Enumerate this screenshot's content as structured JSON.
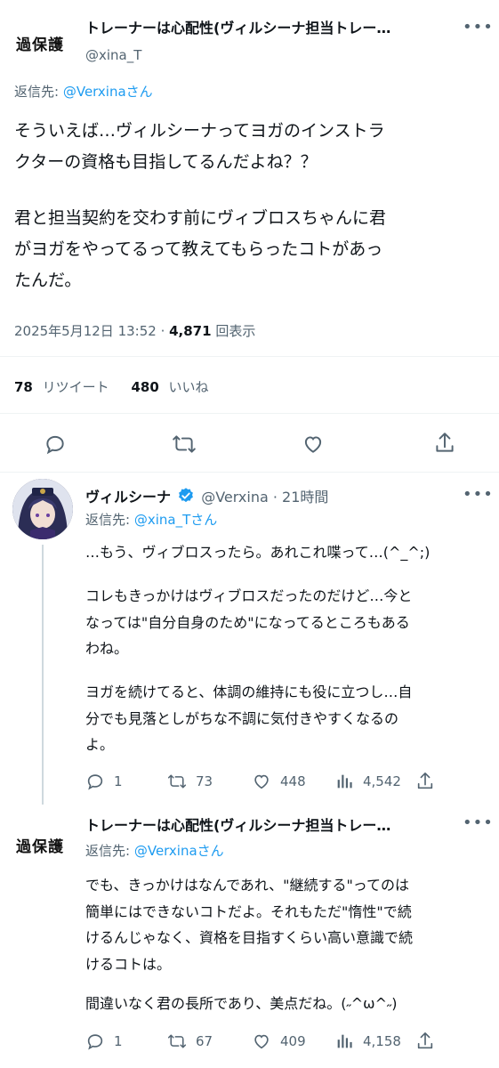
{
  "main_tweet": {
    "avatar_text": "過保護",
    "display_name": "トレーナーは心配性(ヴィルシーナ担当トレー…",
    "handle": "@xina_T",
    "reply_prefix": "返信先:",
    "reply_target": "@Verxinaさん",
    "paragraphs": [
      "そういえば…ヴィルシーナってヨガのインストラ\nクターの資格も目指してるんだよね？？",
      "君と担当契約を交わす前にヴィブロスちゃんに君\nがヨガをやってるって教えてもらったコトがあっ\nたんだ。"
    ],
    "timestamp": "2025年5月12日 13:52 · ",
    "views_count": "4,871",
    "views_label": " 回表示",
    "retweets_count": "78",
    "retweets_label": "リツイート",
    "likes_count": "480",
    "likes_label": "いいね"
  },
  "reply1": {
    "display_name": "ヴィルシーナ",
    "handle_time": "@Verxina · 21時間",
    "reply_prefix": "返信先:",
    "reply_target": "@xina_Tさん",
    "paragraphs": [
      "…もう、ヴィブロスったら。あれこれ喋って…(^_^;)",
      "コレもきっかけはヴィブロスだったのだけど…今と\nなっては\"自分自身のため\"になってるところもある\nわね。",
      "ヨガを続けてると、体調の維持にも役に立つし…自\n分でも見落としがちな不調に気付きやすくなるの\nよ。"
    ],
    "replies": "1",
    "retweets": "73",
    "likes": "448",
    "views": "4,542"
  },
  "reply2": {
    "avatar_text": "過保護",
    "display_name": "トレーナーは心配性(ヴィルシーナ担当トレー…",
    "reply_prefix": "返信先:",
    "reply_target": "@Verxinaさん",
    "paragraphs": [
      "でも、きっかけはなんであれ、\"継続する\"ってのは\n簡単にはできないコトだよ。それもただ\"惰性\"で続\nけるんじゃなく、資格を目指すくらい高い意識で続\nけるコトは。",
      "間違いなく君の長所であり、美点だね。(˶^ω^˶)"
    ],
    "replies": "1",
    "retweets": "67",
    "likes": "409",
    "views": "4,158"
  },
  "colors": {
    "link": "#1d9bf0",
    "muted": "#536471",
    "verified": "#1d9bf0",
    "thread_line": "#cfd9de"
  }
}
